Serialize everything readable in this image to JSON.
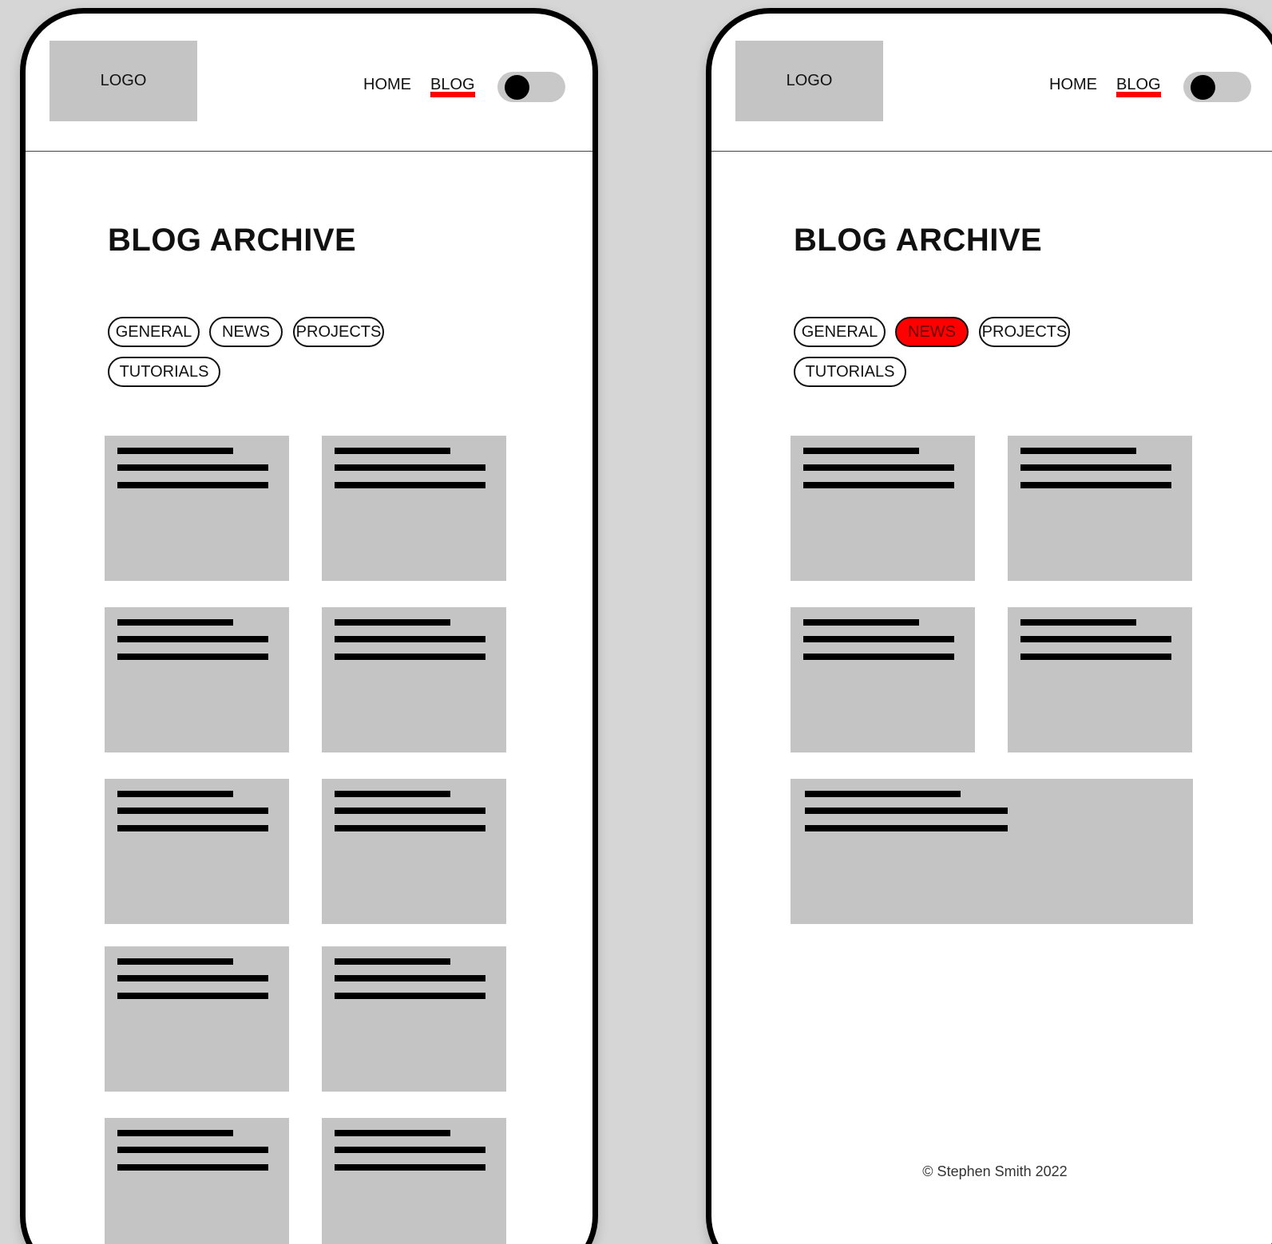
{
  "screens": [
    {
      "header": {
        "logo": "LOGO",
        "nav": [
          {
            "label": "HOME",
            "active": false
          },
          {
            "label": "BLOG",
            "active": true
          }
        ],
        "theme_toggle": {
          "state": "off"
        }
      },
      "page_title": "BLOG ARCHIVE",
      "filters": [
        {
          "label": "GENERAL",
          "selected": false
        },
        {
          "label": "NEWS",
          "selected": false
        },
        {
          "label": "PROJECTS",
          "selected": false
        },
        {
          "label": "TUTORIALS",
          "selected": false
        }
      ],
      "post_card_count": 10
    },
    {
      "header": {
        "logo": "LOGO",
        "nav": [
          {
            "label": "HOME",
            "active": false
          },
          {
            "label": "BLOG",
            "active": true
          }
        ],
        "theme_toggle": {
          "state": "off"
        }
      },
      "page_title": "BLOG ARCHIVE",
      "filters": [
        {
          "label": "GENERAL",
          "selected": false
        },
        {
          "label": "NEWS",
          "selected": true
        },
        {
          "label": "PROJECTS",
          "selected": false
        },
        {
          "label": "TUTORIALS",
          "selected": false
        }
      ],
      "post_card_count": 5,
      "footer": "© Stephen Smith 2022"
    }
  ],
  "colors": {
    "accent": "#ff0000",
    "placeholder": "#c4c4c4",
    "background": "#d6d6d6"
  }
}
